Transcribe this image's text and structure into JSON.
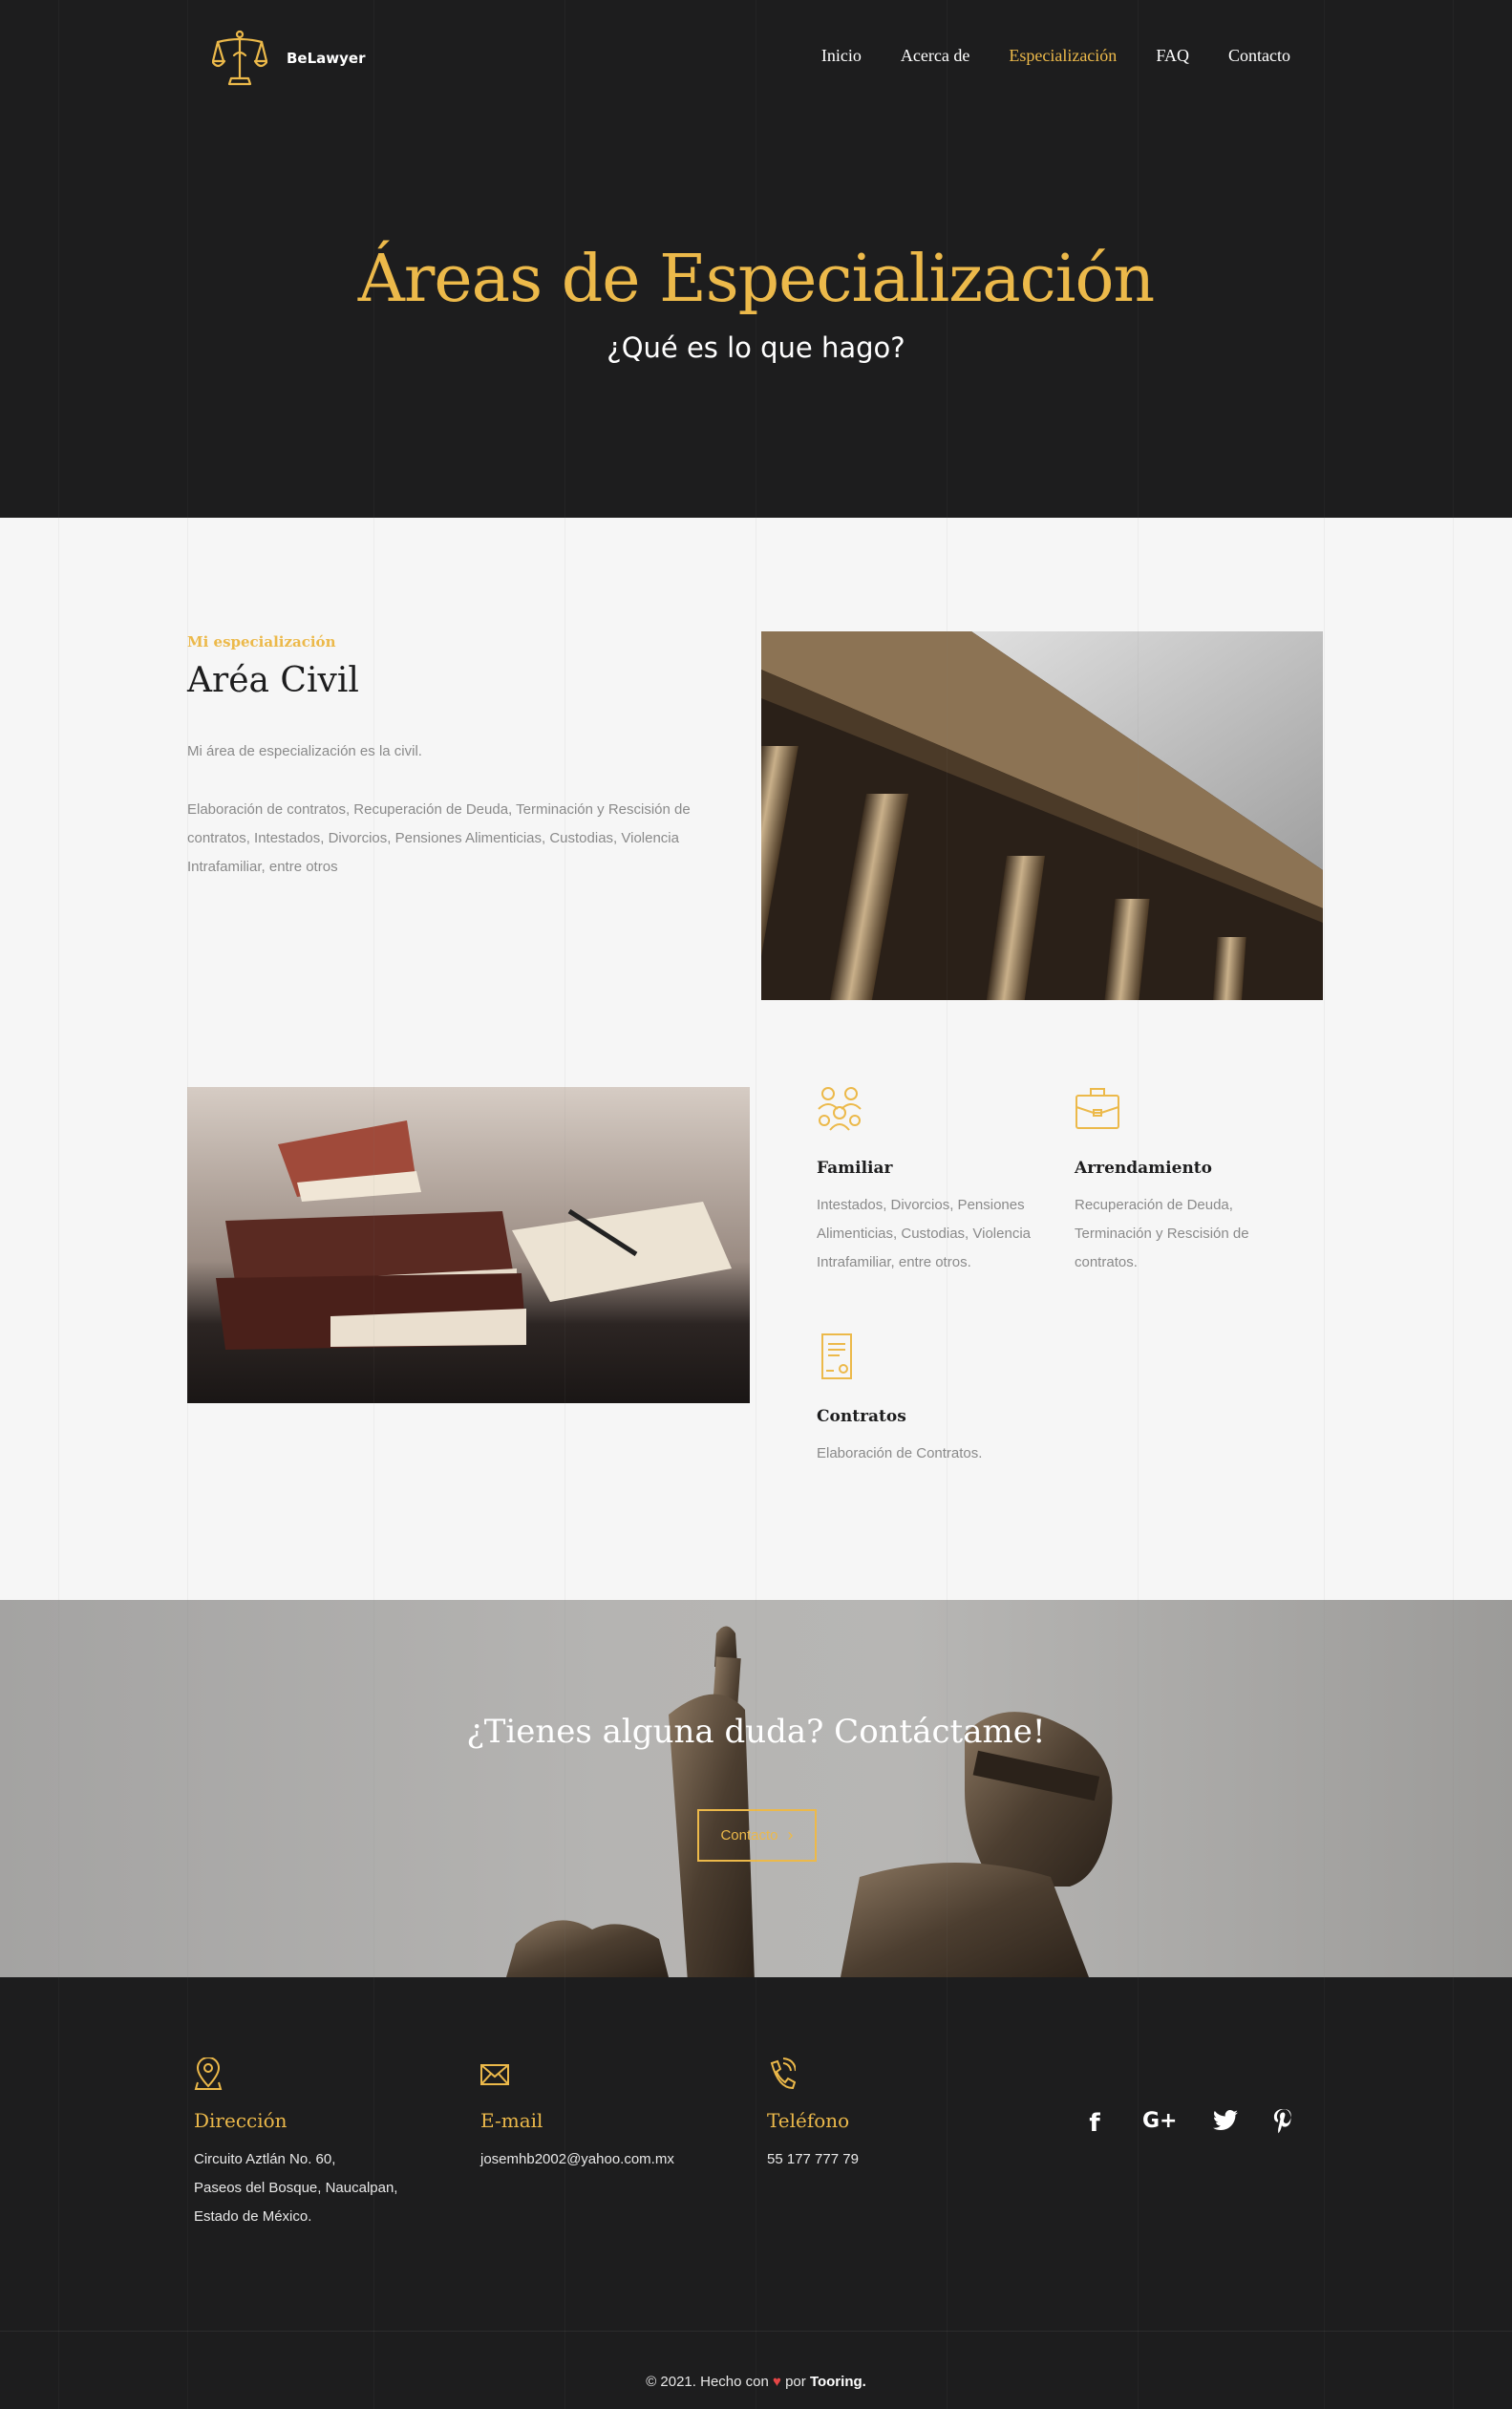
{
  "header": {
    "logo_text": "BeLawyer",
    "nav": [
      "Inicio",
      "Acerca de",
      "Especialización",
      "FAQ",
      "Contacto"
    ],
    "active_nav": "Especialización"
  },
  "hero": {
    "title": "Áreas de Especialización",
    "subtitle": "¿Qué es lo que hago?"
  },
  "civil": {
    "eyebrow": "Mi especialización",
    "title": "Aréa Civil",
    "intro": "Mi área de especialización es la civil.",
    "description": "Elaboración de contratos, Recuperación de Deuda, Terminación y Rescisión de contratos, Intestados, Divorcios, Pensiones Alimenticias, Custodias, Violencia Intrafamiliar, entre otros"
  },
  "services": [
    {
      "title": "Familiar",
      "text": "Intestados, Divorcios, Pensiones Alimenticias, Custodias, Violencia Intrafamiliar, entre otros.",
      "icon": "family-icon"
    },
    {
      "title": "Arrendamiento",
      "text": "Recuperación de Deuda, Terminación y Rescisión de contratos.",
      "icon": "briefcase-icon"
    },
    {
      "title": "Contratos",
      "text": "Elaboración de Contratos.",
      "icon": "contract-icon"
    }
  ],
  "cta": {
    "title": "¿Tienes alguna duda? Contáctame!",
    "button": "Contacto"
  },
  "footer": {
    "address_title": "Dirección",
    "address_lines": [
      "Circuito Aztlán No. 60,",
      "Paseos del Bosque, Naucalpan,",
      "Estado de México."
    ],
    "email_title": "E-mail",
    "email": "josemhb2002@yahoo.com.mx",
    "phone_title": "Teléfono",
    "phone": "55 177 777 79",
    "social": [
      "facebook-icon",
      "google-plus-icon",
      "twitter-icon",
      "pinterest-icon"
    ],
    "copyright_prefix": "© 2021. Hecho con",
    "copyright_mid": "por",
    "copyright_brand": "Tooring."
  },
  "colors": {
    "accent": "#ecb94a",
    "dark": "#1d1d1e",
    "light": "#f6f6f6",
    "muted_text": "#8a8a8a"
  }
}
